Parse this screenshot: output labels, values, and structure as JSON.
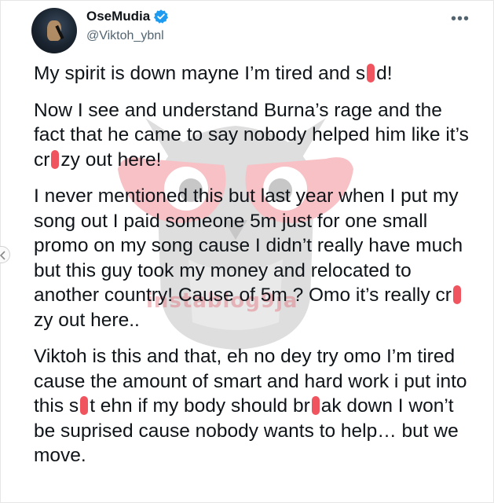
{
  "user": {
    "display_name": "OseMudia",
    "handle": "@Viktoh_ybnl",
    "verified": true
  },
  "more_menu_label": "•••",
  "colors": {
    "verified_badge": "#1d9bf0",
    "censor_mark": "#f0545e",
    "watermark": "#e0707c"
  },
  "watermark_text": "instablog9ja",
  "tweet": {
    "p1": {
      "a": "My spirit is down mayne I’m tired and s",
      "b": "d!"
    },
    "p2": {
      "a": "Now I see and understand Burna’s rage and the fact that he came to say nobody helped him like it’s cr",
      "b": "zy out here!"
    },
    "p3": {
      "a": "I never mentioned this but last year when I put my song out I paid someone 5m just for one small promo on my song cause I didn’t really have much but this guy took my money and relocated to another country! Cause of 5m ? Omo it’s really cr",
      "b": "zy out here.."
    },
    "p4": {
      "a": "Viktoh is this and that, eh no dey try omo I’m tired cause the amount of smart and hard work i put into this s",
      "b": "t ehn if my body should br",
      "c": "ak down I won’t be suprised cause nobody wants to help… but we move."
    }
  }
}
